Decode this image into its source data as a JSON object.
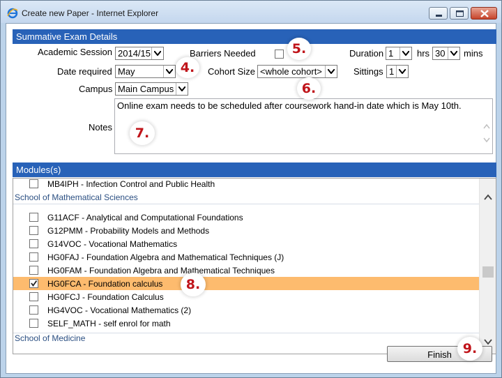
{
  "window": {
    "title": "Create new Paper - Internet Explorer"
  },
  "summative": {
    "header": "Summative Exam Details",
    "academic_session": {
      "label": "Academic Session",
      "value": "2014/15"
    },
    "barriers": {
      "label": "Barriers Needed",
      "checked": false
    },
    "duration": {
      "label": "Duration",
      "hours": "1",
      "hrs_label": "hrs",
      "mins": "30",
      "mins_label": "mins"
    },
    "date_required": {
      "label": "Date required",
      "value": "May"
    },
    "cohort_size": {
      "label": "Cohort Size",
      "value": "<whole cohort>"
    },
    "sittings": {
      "label": "Sittings",
      "value": "1"
    },
    "campus": {
      "label": "Campus",
      "value": "Main Campus"
    },
    "notes": {
      "label": "Notes",
      "value": "Online exam needs to be scheduled after coursework hand-in date which is May 10th."
    }
  },
  "modules": {
    "header": "Modules(s)",
    "top_item": {
      "label": "MB4IPH - Infection Control and Public Health",
      "checked": false
    },
    "group1": "School of Mathematical Sciences",
    "items": [
      {
        "label": "G11ACF - Analytical and Computational Foundations",
        "checked": false
      },
      {
        "label": "G12PMM - Probability Models and Methods",
        "checked": false
      },
      {
        "label": "G14VOC - Vocational Mathematics",
        "checked": false
      },
      {
        "label": "HG0FAJ - Foundation Algebra and Mathematical Techniques (J)",
        "checked": false
      },
      {
        "label": "HG0FAM - Foundation Algebra and Mathematical Techniques",
        "checked": false
      },
      {
        "label": "HG0FCA - Foundation calculus",
        "checked": true,
        "selected": true
      },
      {
        "label": "HG0FCJ - Foundation Calculus",
        "checked": false
      },
      {
        "label": "HG4VOC - Vocational Mathematics (2)",
        "checked": false
      },
      {
        "label": "SELF_MATH - self enrol for math",
        "checked": false
      }
    ],
    "group2": "School of Medicine"
  },
  "finish_label": "Finish",
  "annotations": {
    "a4": "4.",
    "a5": "5.",
    "a6": "6.",
    "a7": "7.",
    "a8": "8.",
    "a9": "9."
  },
  "colors": {
    "header_blue": "#2862b8",
    "selected_row": "#fdbb6e",
    "annotation_red": "#c0141a"
  }
}
